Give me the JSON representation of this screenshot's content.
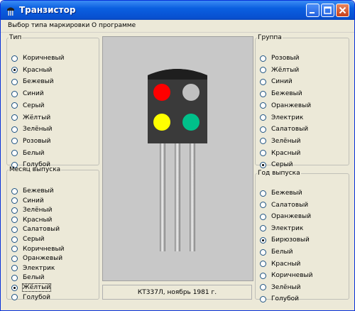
{
  "window": {
    "title": "Транзистор"
  },
  "menu": [
    "Выбор типа маркировки",
    "О программе"
  ],
  "type_group": {
    "legend": "Тип",
    "options": [
      "Коричневый",
      "Красный",
      "Бежевый",
      "Синий",
      "Серый",
      "Жёлтый",
      "Зелёный",
      "Розовый",
      "Белый",
      "Голубой"
    ],
    "selected": 1
  },
  "month_group": {
    "legend": "Месяц выпуска",
    "options": [
      "Бежевый",
      "Синий",
      "Зелёный",
      "Красный",
      "Салатовый",
      "Серый",
      "Коричневый",
      "Оранжевый",
      "Электрик",
      "Белый",
      "Жёлтый",
      "Голубой"
    ],
    "selected": 10
  },
  "group_group": {
    "legend": "Группа",
    "options": [
      "Розовый",
      "Жёлтый",
      "Синий",
      "Бежевый",
      "Оранжевый",
      "Электрик",
      "Салатовый",
      "Зелёный",
      "Красный",
      "Серый"
    ],
    "selected": 9
  },
  "year_group": {
    "legend": "Год выпуска",
    "options": [
      "Бежевый",
      "Салатовый",
      "Оранжевый",
      "Электрик",
      "Бирюзовый",
      "Белый",
      "Красный",
      "Коричневый",
      "Зелёный",
      "Голубой"
    ],
    "selected": 4
  },
  "transistor": {
    "dots": [
      "#ff0000",
      "#c0c0c0",
      "#ffff00",
      "#00c08a"
    ]
  },
  "status_text": "КТ337Л, ноябрь 1981 г."
}
